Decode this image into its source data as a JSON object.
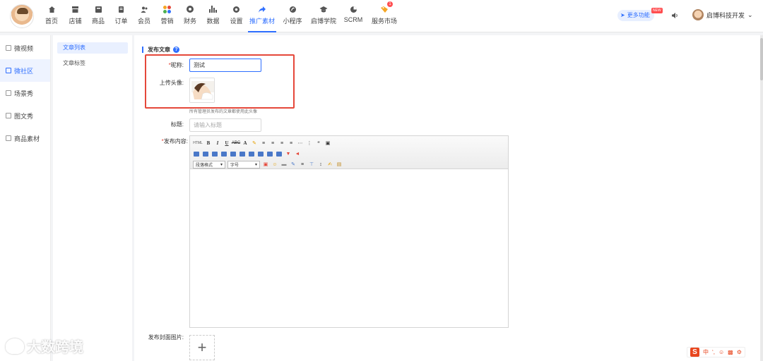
{
  "nav": {
    "items": [
      {
        "label": "首页",
        "icon": "home-icon"
      },
      {
        "label": "店铺",
        "icon": "store-icon"
      },
      {
        "label": "商品",
        "icon": "product-icon"
      },
      {
        "label": "订单",
        "icon": "order-icon"
      },
      {
        "label": "会员",
        "icon": "member-icon"
      },
      {
        "label": "营销",
        "icon": "marketing-icon"
      },
      {
        "label": "财务",
        "icon": "finance-icon"
      },
      {
        "label": "数据",
        "icon": "data-icon"
      },
      {
        "label": "设置",
        "icon": "settings-icon"
      },
      {
        "label": "推广素材",
        "icon": "share-icon"
      },
      {
        "label": "小程序",
        "icon": "miniapp-icon"
      },
      {
        "label": "启博学院",
        "icon": "academy-icon"
      },
      {
        "label": "SCRM",
        "icon": "scrm-icon"
      },
      {
        "label": "服务市场",
        "icon": "market-icon"
      }
    ],
    "active": "推广素材"
  },
  "header": {
    "more_label": "更多功能",
    "new_tag": "NEW",
    "user_name": "启博科技开发",
    "accent": "#2f6fff"
  },
  "sidebar": {
    "items": [
      {
        "label": "微视频"
      },
      {
        "label": "微社区"
      },
      {
        "label": "场景秀"
      },
      {
        "label": "图文秀"
      },
      {
        "label": "商品素材"
      }
    ],
    "active": "微社区"
  },
  "subnav": {
    "items": [
      {
        "label": "文章列表"
      },
      {
        "label": "文章标签"
      }
    ],
    "active": "文章列表"
  },
  "form": {
    "section_title": "发布文章",
    "nickname_label": "昵称:",
    "nickname_value": "测试",
    "avatar_label": "上传头像:",
    "avatar_hint": "所有管理员发布的文章都使用此头像",
    "title_label": "标题:",
    "title_placeholder": "请输入标题",
    "content_label": "发布内容:",
    "cover_label": "发布封面图片:",
    "highlight_color": "#e5483a"
  },
  "editor": {
    "paragraph_select": "段落格式",
    "font_size_select": "字号"
  },
  "watermark": "大数跨境",
  "ime": {
    "mode": "中"
  }
}
